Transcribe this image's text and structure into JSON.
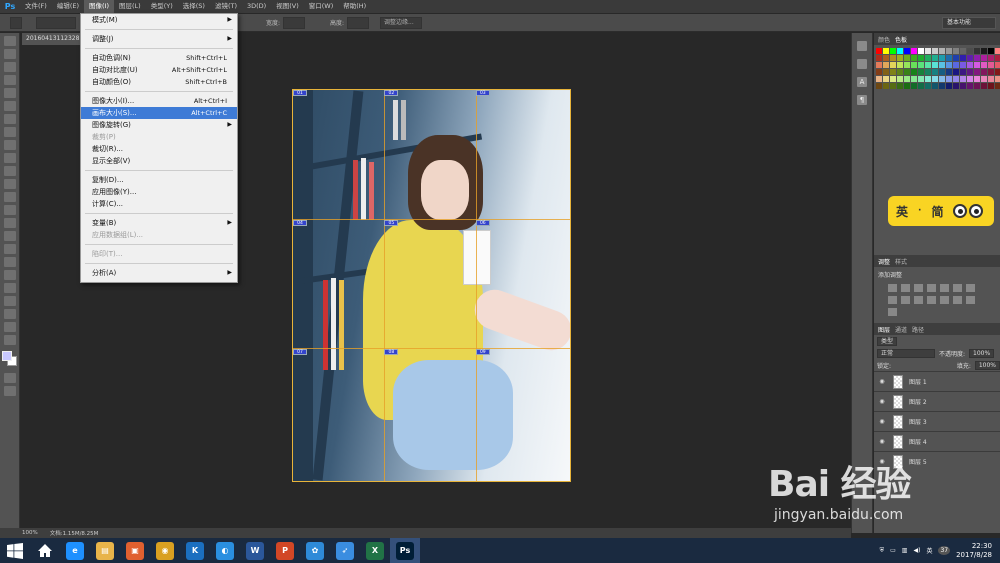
{
  "app": {
    "logo": "Ps"
  },
  "menubar": {
    "items": [
      "文件(F)",
      "编辑(E)",
      "图像(I)",
      "图层(L)",
      "类型(Y)",
      "选择(S)",
      "滤镜(T)",
      "3D(D)",
      "视图(V)",
      "窗口(W)",
      "帮助(H)"
    ],
    "active_index": 2
  },
  "options": {
    "width_label": "宽度:",
    "height_label": "高度:",
    "adjust_button": "调整边缘...",
    "workspace": "基本功能"
  },
  "document": {
    "tab": "20160413112328..."
  },
  "image_menu": {
    "items": [
      {
        "label": "模式(M)",
        "shortcut": "",
        "submenu": true,
        "disabled": false,
        "highlighted": false,
        "sep_after": true
      },
      {
        "label": "调整(J)",
        "shortcut": "",
        "submenu": true,
        "disabled": false,
        "highlighted": false,
        "sep_after": true
      },
      {
        "label": "自动色调(N)",
        "shortcut": "Shift+Ctrl+L",
        "submenu": false,
        "disabled": false,
        "highlighted": false,
        "sep_after": false
      },
      {
        "label": "自动对比度(U)",
        "shortcut": "Alt+Shift+Ctrl+L",
        "submenu": false,
        "disabled": false,
        "highlighted": false,
        "sep_after": false
      },
      {
        "label": "自动颜色(O)",
        "shortcut": "Shift+Ctrl+B",
        "submenu": false,
        "disabled": false,
        "highlighted": false,
        "sep_after": true
      },
      {
        "label": "图像大小(I)...",
        "shortcut": "Alt+Ctrl+I",
        "submenu": false,
        "disabled": false,
        "highlighted": false,
        "sep_after": false
      },
      {
        "label": "画布大小(S)...",
        "shortcut": "Alt+Ctrl+C",
        "submenu": false,
        "disabled": false,
        "highlighted": true,
        "sep_after": false
      },
      {
        "label": "图像旋转(G)",
        "shortcut": "",
        "submenu": true,
        "disabled": false,
        "highlighted": false,
        "sep_after": false
      },
      {
        "label": "裁剪(P)",
        "shortcut": "",
        "submenu": false,
        "disabled": true,
        "highlighted": false,
        "sep_after": false
      },
      {
        "label": "裁切(R)...",
        "shortcut": "",
        "submenu": false,
        "disabled": false,
        "highlighted": false,
        "sep_after": false
      },
      {
        "label": "显示全部(V)",
        "shortcut": "",
        "submenu": false,
        "disabled": false,
        "highlighted": false,
        "sep_after": true
      },
      {
        "label": "复制(D)...",
        "shortcut": "",
        "submenu": false,
        "disabled": false,
        "highlighted": false,
        "sep_after": false
      },
      {
        "label": "应用图像(Y)...",
        "shortcut": "",
        "submenu": false,
        "disabled": false,
        "highlighted": false,
        "sep_after": false
      },
      {
        "label": "计算(C)...",
        "shortcut": "",
        "submenu": false,
        "disabled": false,
        "highlighted": false,
        "sep_after": true
      },
      {
        "label": "变量(B)",
        "shortcut": "",
        "submenu": true,
        "disabled": false,
        "highlighted": false,
        "sep_after": false
      },
      {
        "label": "应用数据组(L)...",
        "shortcut": "",
        "submenu": false,
        "disabled": true,
        "highlighted": false,
        "sep_after": true
      },
      {
        "label": "陷印(T)...",
        "shortcut": "",
        "submenu": false,
        "disabled": true,
        "highlighted": false,
        "sep_after": true
      },
      {
        "label": "分析(A)",
        "shortcut": "",
        "submenu": true,
        "disabled": false,
        "highlighted": false,
        "sep_after": false
      }
    ]
  },
  "slices": [
    "01",
    "02",
    "03",
    "04",
    "05",
    "06",
    "07",
    "08",
    "09"
  ],
  "swatch_panel": {
    "tabs": [
      "颜色",
      "色板"
    ]
  },
  "ime": {
    "char1": "英",
    "char2": "简"
  },
  "adjust_panel": {
    "tabs": [
      "调整",
      "样式"
    ],
    "title": "添加调整"
  },
  "layers_panel": {
    "tabs": [
      "图层",
      "通道",
      "路径"
    ],
    "kind": "类型",
    "blend": "正常",
    "opacity_label": "不透明度:",
    "opacity": "100%",
    "lock_label": "锁定:",
    "fill_label": "填充:",
    "fill": "100%",
    "layers": [
      "图层 1",
      "图层 2",
      "图层 3",
      "图层 4",
      "图层 5"
    ]
  },
  "status": {
    "zoom": "100%",
    "doc": "文档:1.15M/8.25M"
  },
  "taskbar": {
    "apps": [
      {
        "name": "ie",
        "glyph": "e",
        "color": "#1e90ff"
      },
      {
        "name": "explorer",
        "glyph": "▤",
        "color": "#e8b44a"
      },
      {
        "name": "app-orange",
        "glyph": "▣",
        "color": "#e06030"
      },
      {
        "name": "app-gold",
        "glyph": "◉",
        "color": "#d9a021"
      },
      {
        "name": "app-k",
        "glyph": "K",
        "color": "#1b6fc0"
      },
      {
        "name": "app-qq-browser",
        "glyph": "◐",
        "color": "#2a8fe0"
      },
      {
        "name": "word",
        "glyph": "W",
        "color": "#2b579a"
      },
      {
        "name": "powerpoint",
        "glyph": "P",
        "color": "#d24726"
      },
      {
        "name": "app-blue",
        "glyph": "✿",
        "color": "#2e8ad8"
      },
      {
        "name": "app-bird",
        "glyph": "➶",
        "color": "#3a8de0"
      },
      {
        "name": "excel",
        "glyph": "X",
        "color": "#217346"
      },
      {
        "name": "photoshop",
        "glyph": "Ps",
        "color": "#001e36"
      }
    ],
    "active_index": 11,
    "tray_num": "37",
    "time": "22:30",
    "date": "2017/8/28"
  },
  "watermark": {
    "main": "Bai 经验",
    "sub": "jingyan.baidu.com"
  }
}
